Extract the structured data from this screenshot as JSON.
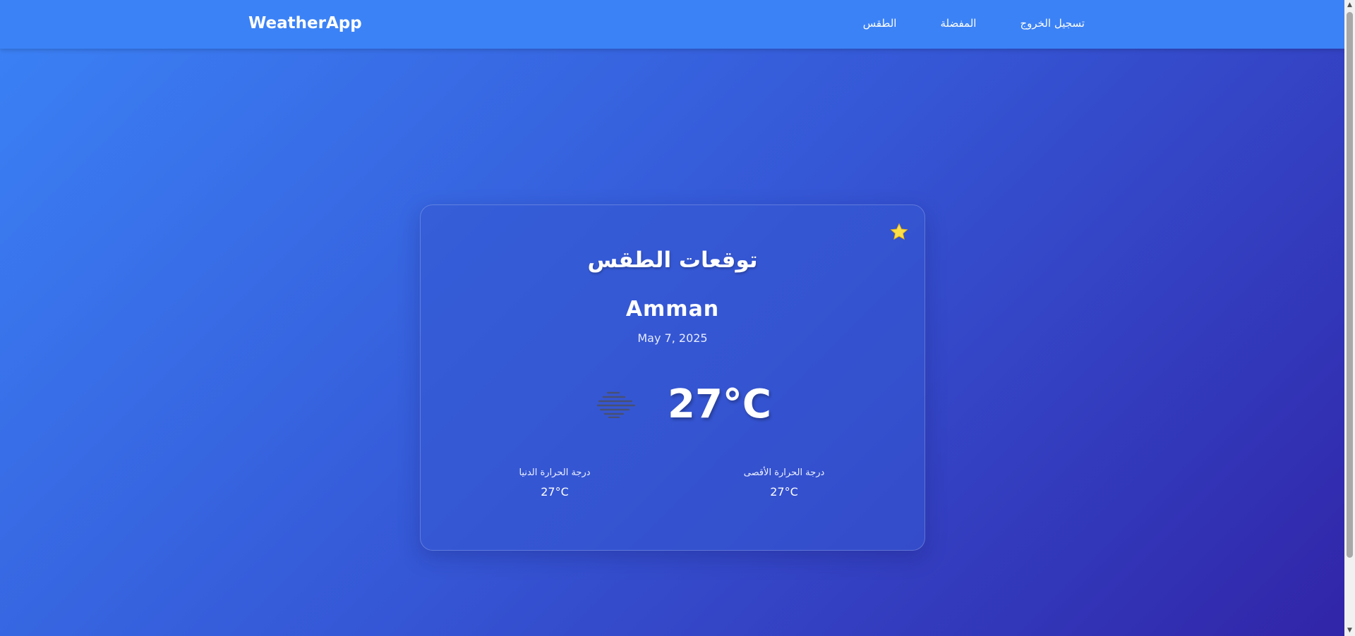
{
  "navbar": {
    "brand": "WeatherApp",
    "links": [
      "تسجيل الخروج",
      "المفضلة",
      "الطقس"
    ]
  },
  "card": {
    "title": "توقعات الطقس",
    "city": "Amman",
    "date": "May 7, 2025",
    "icon": "fog-icon",
    "temperature": "27°C",
    "min_label": "درجة الحرارة الدنيا",
    "min_value": "27°C",
    "max_label": "درجة الحرارة الأقصى",
    "max_value": "27°C",
    "favorite_icon": "star-icon"
  },
  "colors": {
    "navbar": "#3b82f6",
    "gradient_start": "#3b82f6",
    "gradient_end": "#3124a8",
    "star": "#fde047"
  }
}
